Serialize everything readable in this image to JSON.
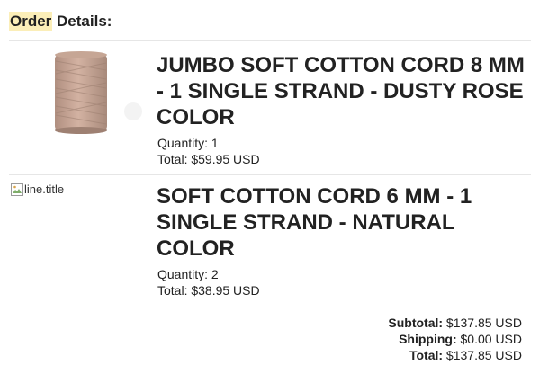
{
  "heading": {
    "highlighted": "Order",
    "rest": " Details:"
  },
  "items": [
    {
      "title": "JUMBO SOFT COTTON CORD 8 MM - 1 SINGLE STRAND - DUSTY ROSE COLOR",
      "quantity": "Quantity: 1",
      "total": "Total: $59.95 USD",
      "image_alt": ""
    },
    {
      "title": "SOFT COTTON CORD 6 MM - 1 SINGLE STRAND - NATURAL COLOR",
      "quantity": "Quantity: 2",
      "total": "Total: $38.95 USD",
      "image_alt": "line.title"
    }
  ],
  "totals": {
    "subtotal_label": "Subtotal:",
    "subtotal_value": " $137.85 USD",
    "shipping_label": "Shipping:",
    "shipping_value": " $0.00 USD",
    "total_label": "Total:",
    "total_value": " $137.85 USD"
  },
  "colors": {
    "highlight": "#fbeeb8",
    "divider": "#e6e6e6",
    "cord": "#c9a593"
  }
}
